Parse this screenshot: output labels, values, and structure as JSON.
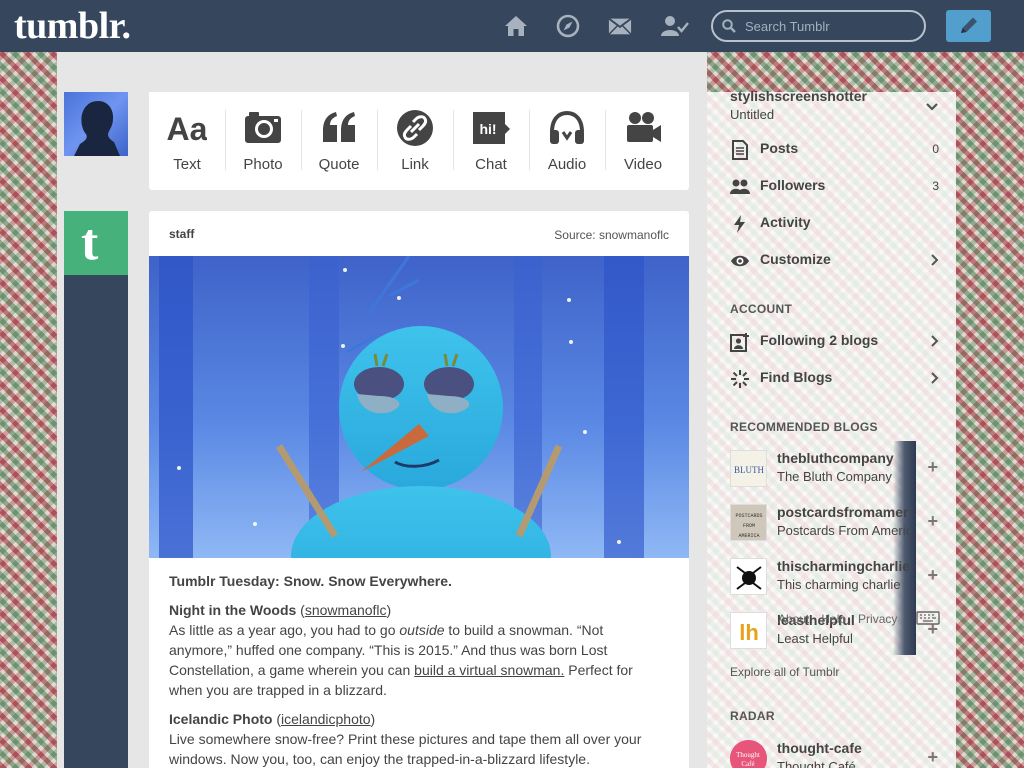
{
  "header": {
    "logo": "tumblr.",
    "nav_icons": [
      "home-icon",
      "explore-icon",
      "inbox-icon",
      "account-icon"
    ],
    "search_placeholder": "Search Tumblr",
    "compose_icon": "pencil-icon",
    "colors": {
      "bar": "#36465d",
      "compose": "#529ecc"
    }
  },
  "post_types": [
    {
      "label": "Text",
      "icon": "text-icon"
    },
    {
      "label": "Photo",
      "icon": "camera-icon"
    },
    {
      "label": "Quote",
      "icon": "quote-icon"
    },
    {
      "label": "Link",
      "icon": "link-icon"
    },
    {
      "label": "Chat",
      "icon": "chat-icon",
      "badge": "hi!"
    },
    {
      "label": "Audio",
      "icon": "headphones-icon"
    },
    {
      "label": "Video",
      "icon": "video-camera-icon"
    }
  ],
  "post": {
    "author": "staff",
    "source": "Source: snowmanoflc",
    "title": "Tumblr Tuesday: Snow. Snow Everywhere.",
    "section1_head": "Night in the Woods",
    "section1_paren_open": " (",
    "section1_link": "snowmanoflc",
    "section1_paren_close": ")",
    "section1_text_a": "As little as a year ago, you had to go ",
    "section1_em": "outside",
    "section1_text_b": " to build a snowman. “Not anymore,” huffed one company. “This is 2015.” And thus was born Lost Constellation, a game wherein you can ",
    "section1_link2": "build a virtual snowman.",
    "section1_text_c": " Perfect for when you are trapped in a blizzard.",
    "section2_head": "Icelandic Photo",
    "section2_paren_open": " (",
    "section2_link": "icelandicphoto",
    "section2_paren_close": ")",
    "section2_text": "Live somewhere snow-free? Print these pictures and tape them all over your windows. Now you, too, can enjoy the trapped-in-a-blizzard lifestyle."
  },
  "sidebar": {
    "blog_name": "stylishscreenshotter",
    "blog_title": "Untitled",
    "items": [
      {
        "label": "Posts",
        "count": "0",
        "icon": "posts-icon"
      },
      {
        "label": "Followers",
        "count": "3",
        "icon": "followers-icon"
      },
      {
        "label": "Activity",
        "count": "",
        "icon": "activity-icon"
      },
      {
        "label": "Customize",
        "count": "",
        "icon": "eye-icon"
      }
    ],
    "account_heading": "ACCOUNT",
    "account_items": [
      {
        "label": "Following 2 blogs",
        "icon": "following-icon"
      },
      {
        "label": "Find Blogs",
        "icon": "find-blogs-icon"
      }
    ],
    "recommended_heading": "RECOMMENDED BLOGS",
    "recommended": [
      {
        "name": "thebluthcompany",
        "title": "The Bluth Company",
        "avatar_text": "BLUTH"
      },
      {
        "name": "postcardsfromamerica",
        "title": "Postcards From America",
        "avatar_text": "POSTCARDS FROM AMERICA"
      },
      {
        "name": "thischarmingcharlie",
        "title": "This charming charlie",
        "avatar_text": ""
      },
      {
        "name": "leasthelpful",
        "title": "Least Helpful",
        "avatar_text": "lh"
      }
    ],
    "footer_links": [
      "About",
      "Help",
      "Privacy"
    ],
    "explore": "Explore all of Tumblr",
    "radar_heading": "RADAR",
    "radar": {
      "name": "thought-cafe",
      "title": "Thought Café",
      "avatar_text": "Thought Café"
    }
  }
}
